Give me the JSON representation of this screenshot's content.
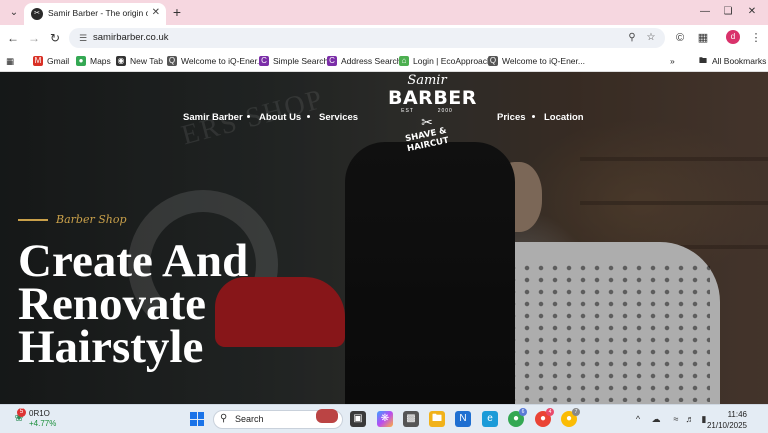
{
  "browser": {
    "tab": {
      "title": "Samir Barber - The origin of Ha"
    },
    "address": {
      "url": "samirbarber.co.uk"
    },
    "profile_initial": "d",
    "bookmarks": [
      {
        "label": "Gmail",
        "icon": "gmail-icon",
        "color": "#d93025"
      },
      {
        "label": "Maps",
        "icon": "maps-icon",
        "color": "#34a853"
      },
      {
        "label": "New Tab",
        "icon": "globe-icon",
        "color": "#333333"
      },
      {
        "label": "Welcome to iQ-Ener...",
        "icon": "iq-icon",
        "color": "#555555"
      },
      {
        "label": "Simple Search",
        "icon": "c-icon",
        "color": "#7b2ea8"
      },
      {
        "label": "Address Search",
        "icon": "c-icon",
        "color": "#7b2ea8"
      },
      {
        "label": "Login | EcoApproach",
        "icon": "house-icon",
        "color": "#4caf50"
      },
      {
        "label": "Welcome to iQ-Ener...",
        "icon": "iq-icon",
        "color": "#555555"
      }
    ],
    "all_bookmarks": "All Bookmarks"
  },
  "site": {
    "nav": {
      "barber": "Samir Barber",
      "about": "About Us",
      "services": "Services",
      "prices": "Prices",
      "location": "Location"
    },
    "logo": {
      "script": "Samir",
      "main": "BARBER",
      "est_left": "EST",
      "est_right": "2000",
      "arc": "SHAVE & HAIRCUT"
    },
    "hero": {
      "tagline": "Barber Shop",
      "headline": [
        "Create And",
        "Renovate",
        "Hairstyle"
      ]
    },
    "background_text": "ERS SHOP"
  },
  "taskbar": {
    "ticker_name": "0R1O",
    "ticker_change": "+4.77%",
    "weather_badge": "5",
    "search_placeholder": "Search",
    "time": "11:46",
    "date": "21/10/2025",
    "badges": {
      "edge_alt": "6",
      "chrome": "4",
      "chrome_profile": "7"
    },
    "accent": "#1a73e8"
  }
}
